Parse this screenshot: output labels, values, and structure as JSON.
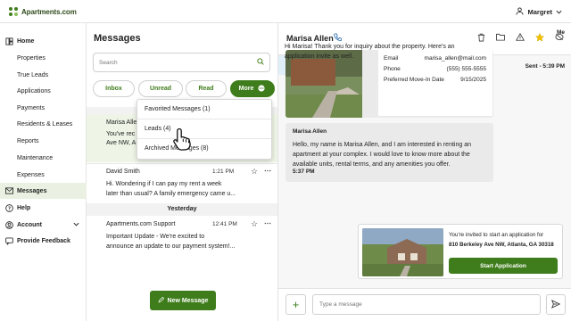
{
  "app": {
    "logo_text": "Apartments.com",
    "user_name": "Margret"
  },
  "sidebar": {
    "items": [
      {
        "label": "Home",
        "icon": "home-icon"
      },
      {
        "label": "Properties"
      },
      {
        "label": "True Leads"
      },
      {
        "label": "Applications"
      },
      {
        "label": "Payments"
      },
      {
        "label": "Residents & Leases"
      },
      {
        "label": "Reports"
      },
      {
        "label": "Maintenance"
      },
      {
        "label": "Expenses"
      },
      {
        "label": "Messages",
        "icon": "envelope-icon",
        "active": true
      },
      {
        "label": "Help",
        "icon": "help-icon"
      },
      {
        "label": "Account",
        "icon": "account-icon"
      },
      {
        "label": "Provide Feedback",
        "icon": "feedback-icon"
      }
    ]
  },
  "messages_panel": {
    "title": "Messages",
    "search_placeholder": "Search",
    "filters": [
      "Inbox",
      "Unread",
      "Read",
      "More"
    ],
    "dropdown": [
      "Favorited Messages (1)",
      "Leads (4)",
      "Archived Messages (8)"
    ],
    "conversations": [
      {
        "name": "Marisa Allen",
        "preview": "You've rec... Ave NW, A...",
        "preview_l1": "You've rec",
        "preview_l2": "Ave NW, A"
      },
      {
        "name": "David Smith",
        "time": "1:21 PM",
        "preview_l1": "Hi. Wondering if I can pay my rent a week",
        "preview_l2": "later than usual? A family emergency came u..."
      },
      {
        "name": "Apartments.com Support",
        "time": "12:41 PM",
        "preview_l1": "Important Update - We're excited to",
        "preview_l2": "announce an update to our payment system!..."
      }
    ],
    "day_separator": "Yesterday",
    "new_message_label": "New Message"
  },
  "chat": {
    "contact_name": "Marisa Allen",
    "details": [
      {
        "key": "Email",
        "value": "marisa_allen@mail.com"
      },
      {
        "key": "Phone",
        "value": "(555) 555-5555"
      },
      {
        "key": "Preferred Move-In Date",
        "value": "9/15/2025"
      }
    ],
    "incoming": {
      "sender": "Marisa Allen",
      "text": "Hello, my name is Marisa Allen, and I am interested in renting an apartment at your complex. I would love to know more about the available units, rental terms, and any amenities you offer.",
      "time": "5:37 PM"
    },
    "outgoing": {
      "sender": "Me",
      "text": "Hi Marisa! Thank you for inquiry about the property. Here's an application invite as well.",
      "status": "Sent - 5:39 PM"
    },
    "invite": {
      "line1": "You're invited to start an application for",
      "address": "810 Berkeley Ave NW, Atlanta, GA 30318",
      "button": "Start Application"
    },
    "composer_placeholder": "Type a message"
  },
  "colors": {
    "brand_green": "#3f7d1c",
    "outgoing_bubble": "#e0eef8",
    "highlight": "#eef4e6"
  }
}
